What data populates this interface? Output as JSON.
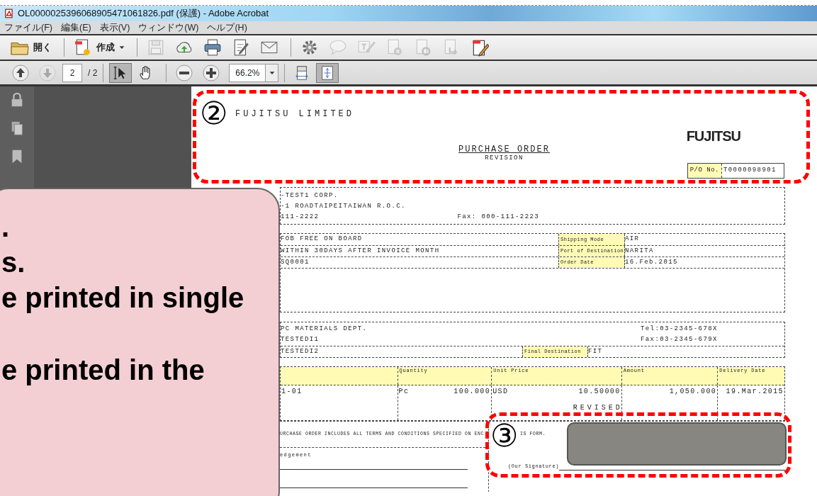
{
  "window": {
    "title": "OL0000025396068905471061826.pdf (保護) - Adobe Acrobat"
  },
  "menu": [
    "ファイル(F)",
    "編集(E)",
    "表示(V)",
    "ウィンドウ(W)",
    "ヘルプ(H)"
  ],
  "toolbar": [
    {
      "label": "開く",
      "disabled": false
    },
    {
      "label": "作成",
      "disabled": false,
      "dropdown": true
    },
    {
      "disabled": true
    },
    {
      "disabled": false
    },
    {
      "disabled": false
    },
    {
      "disabled": false
    },
    {
      "disabled": false
    },
    {
      "disabled": false
    },
    {
      "disabled": true
    },
    {
      "disabled": true
    },
    {
      "disabled": true
    },
    {
      "disabled": true
    },
    {
      "disabled": true
    },
    {
      "disabled": false
    }
  ],
  "nav": {
    "buttons": [
      {
        "disabled": false
      },
      {
        "disabled": true
      }
    ],
    "page": "2",
    "page_count": "/ 2",
    "tools": [
      {
        "selected": true
      },
      {
        "selected": false
      }
    ],
    "zoom": "66.2%",
    "views": [
      {
        "selected": false
      },
      {
        "selected": true
      }
    ]
  },
  "document": {
    "company": "FUJITSU LIMITED",
    "logo": "FUJITSU",
    "title": "PURCHASE ORDER",
    "subtitle": "REVISION",
    "po_label": "P/O No.",
    "po_number": "T0000098901",
    "supplier": [
      "-TEST1 CORP.",
      "-1 ROADTAIPEITAIWAN R.O.C.",
      "111-2222"
    ],
    "supplier_fax": "Fax: 000-111-2223",
    "terms": [
      {
        "text": "FOB FREE ON BOARD",
        "label": "Shipping Mode",
        "value": "AIR"
      },
      {
        "text": "WITHIN 30DAYS AFTER INVOICE MONTH",
        "label": "Port of Destination",
        "value": "NARITA"
      },
      {
        "text": "SQ0001",
        "label": "Order Date",
        "value": "16.Feb.2015"
      }
    ],
    "buyer": {
      "lines": [
        "PC MATERIALS DEPT.",
        "TESTEDI1"
      ],
      "contacts": [
        "Tel:03-2345-678X",
        "Fax:03-2345-679X"
      ],
      "line_3": "TESTEDI2",
      "label": "Final Destination",
      "value": "FIT"
    },
    "items": {
      "columns": [
        "Quantity",
        "Unit Price",
        "Amount",
        "Delivery Date"
      ],
      "rows": [
        {
          "item": "1-01",
          "unit": "Pc",
          "quantity": "100.000",
          "currency": "USD",
          "unit_price": "10.50000",
          "amount": "1,050.000",
          "delivery_date": "19.Mar.2015"
        }
      ],
      "note": "REVISED"
    },
    "clause": [
      "URCHASE ORDER INCLUDES ALL TERMS AND CONDITIONS SPECIFIED ON ENC",
      "IS FORM."
    ],
    "acknowledgement": "edgement",
    "signature_label": "(Our Signature)"
  },
  "annotations": {
    "markers": [
      "②",
      "③"
    ],
    "callout": [
      ".",
      "s.",
      "e printed in single",
      "e printed in the"
    ]
  }
}
